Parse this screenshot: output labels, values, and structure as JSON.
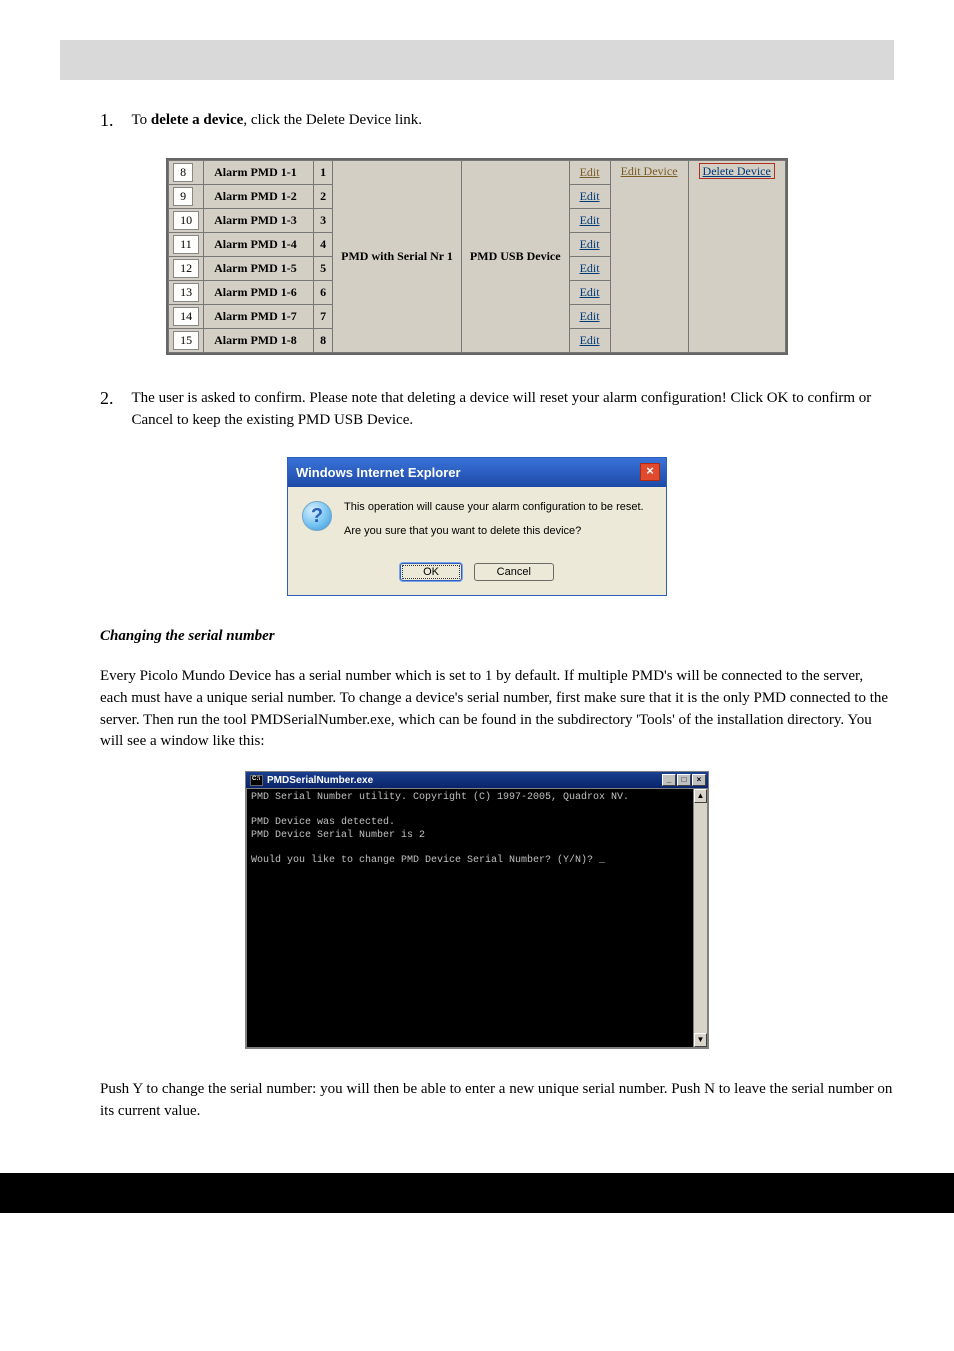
{
  "section1": {
    "number": "1.",
    "text_before": "To ",
    "text_bold": "delete a device",
    "text_after": ", click the Delete Device link."
  },
  "alarm_table": {
    "rows": [
      {
        "idx": "8",
        "name": "Alarm PMD 1-1",
        "ch": "1",
        "edit": "Edit",
        "edit_device": "Edit Device",
        "delete_device": "Delete Device"
      },
      {
        "idx": "9",
        "name": "Alarm PMD 1-2",
        "ch": "2",
        "edit": "Edit"
      },
      {
        "idx": "10",
        "name": "Alarm PMD 1-3",
        "ch": "3",
        "edit": "Edit"
      },
      {
        "idx": "11",
        "name": "Alarm PMD 1-4",
        "ch": "4",
        "edit": "Edit"
      },
      {
        "idx": "12",
        "name": "Alarm PMD 1-5",
        "ch": "5",
        "edit": "Edit"
      },
      {
        "idx": "13",
        "name": "Alarm PMD 1-6",
        "ch": "6",
        "edit": "Edit"
      },
      {
        "idx": "14",
        "name": "Alarm PMD 1-7",
        "ch": "7",
        "edit": "Edit"
      },
      {
        "idx": "15",
        "name": "Alarm PMD 1-8",
        "ch": "8",
        "edit": "Edit"
      }
    ],
    "mid_left": "PMD with Serial Nr 1",
    "mid_right": "PMD USB Device"
  },
  "section2": {
    "number": "2.",
    "text": "The user is asked to confirm. Please note that deleting a device will reset your alarm configuration! Click OK to confirm or Cancel to keep the existing PMD USB Device."
  },
  "ie_dialog": {
    "title": "Windows Internet Explorer",
    "line1": "This operation will cause your alarm configuration to be reset.",
    "line2": "Are you sure that you want to delete this device?",
    "ok": "OK",
    "cancel": "Cancel"
  },
  "subsection": {
    "heading": "Changing the serial number",
    "para1": "Every Picolo Mundo Device has a serial number which is set to 1 by default. If multiple PMD's will be connected to the server, each must have a unique serial number. To change a device's serial number, first make sure that it is the only PMD connected to the server. Then run the tool PMDSerialNumber.exe, which can be found in the subdirectory 'Tools' of the installation directory. You will see a window like this:"
  },
  "console": {
    "title": "PMDSerialNumber.exe",
    "lines": [
      "PMD Serial Number utility. Copyright (C) 1997-2005, Quadrox NV.",
      "",
      "PMD Device was detected.",
      "PMD Device Serial Number is 2",
      "",
      "Would you like to change PMD Device Serial Number? (Y/N)? _"
    ]
  },
  "tail": {
    "para": "Push Y to change the serial number: you will then be able to enter a new unique serial number. Push N to leave the serial number on its current value."
  }
}
